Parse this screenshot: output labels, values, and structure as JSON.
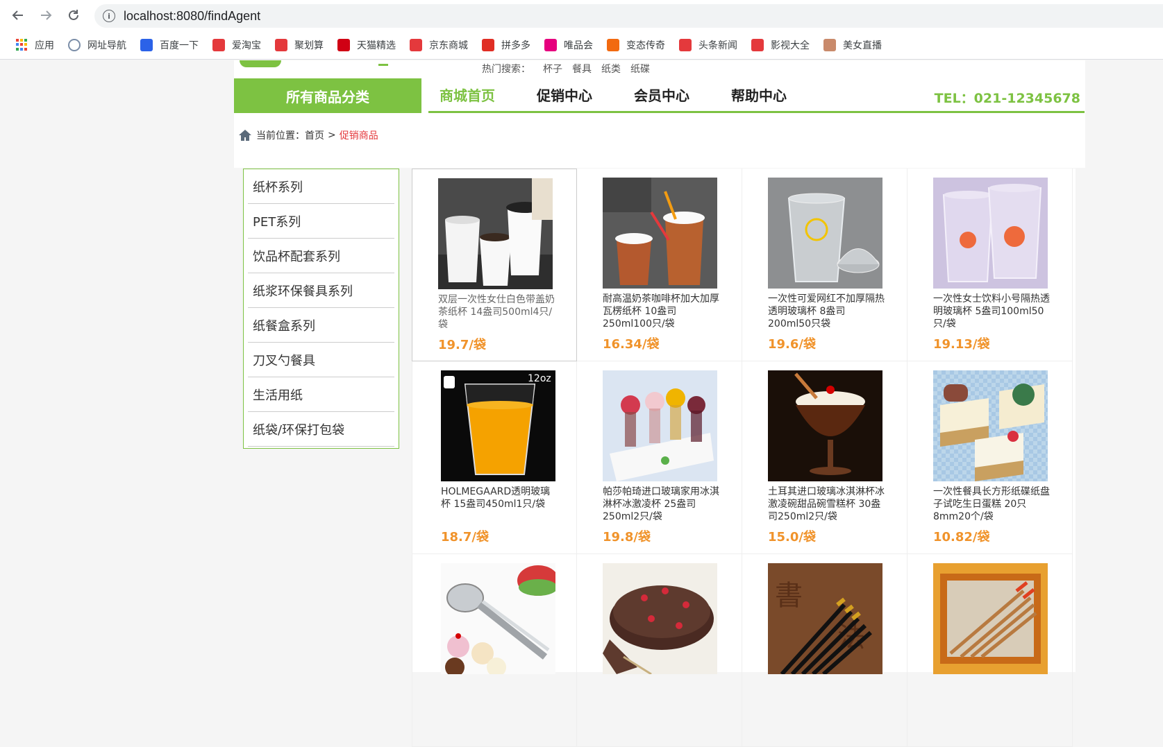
{
  "browser": {
    "url": "localhost:8080/findAgent",
    "bookmarks": [
      {
        "label": "应用",
        "icon": "apps-grid-icon",
        "color": "#4285f4"
      },
      {
        "label": "网址导航",
        "icon": "globe-icon",
        "color": "#7b8ea8"
      },
      {
        "label": "百度一下",
        "icon": "baidu-paw-icon",
        "color": "#2b62e8"
      },
      {
        "label": "爱淘宝",
        "icon": "taobao-icon",
        "color": "#e4393c"
      },
      {
        "label": "聚划算",
        "icon": "juhuasuan-icon",
        "color": "#e4393c"
      },
      {
        "label": "天猫精选",
        "icon": "tmall-icon",
        "color": "#d00014"
      },
      {
        "label": "京东商城",
        "icon": "jd-icon",
        "color": "#e4393c"
      },
      {
        "label": "拼多多",
        "icon": "pinduoduo-icon",
        "color": "#e02e24"
      },
      {
        "label": "唯品会",
        "icon": "vip-icon",
        "color": "#e6007e"
      },
      {
        "label": "变态传奇",
        "icon": "game-icon",
        "color": "#f26a10"
      },
      {
        "label": "头条新闻",
        "icon": "toutiao-icon",
        "color": "#e4393c"
      },
      {
        "label": "影视大全",
        "icon": "play-icon",
        "color": "#e4393c"
      },
      {
        "label": "美女直播",
        "icon": "avatar-icon",
        "color": "#c98a6b"
      }
    ]
  },
  "header": {
    "hot_search_label": "热门搜索：",
    "hot_search": [
      "杯子",
      "餐具",
      "纸类",
      "纸碟"
    ],
    "category_button": "所有商品分类",
    "nav": [
      "商城首页",
      "促销中心",
      "会员中心",
      "帮助中心"
    ],
    "tel": "TEL：021-12345678"
  },
  "breadcrumb": {
    "prefix": "当前位置：",
    "home": "首页",
    "sep": ">",
    "current": "促销商品"
  },
  "sidebar": {
    "items": [
      "纸杯系列",
      "PET系列",
      "饮品杯配套系列",
      "纸浆环保餐具系列",
      "纸餐盒系列",
      "刀叉勺餐具",
      "生活用纸",
      "纸袋/环保打包袋"
    ]
  },
  "products": [
    {
      "name": "双层一次性女仕白色带盖奶茶纸杯 14盎司500ml4只/袋",
      "price": "19.7/袋"
    },
    {
      "name": "耐高温奶茶咖啡杯加大加厚瓦楞纸杯 10盎司250ml100只/袋",
      "price": "16.34/袋"
    },
    {
      "name": "一次性可爱网红不加厚隔热透明玻璃杯 8盎司200ml50只袋",
      "price": "19.6/袋"
    },
    {
      "name": "一次性女士饮料小号隔热透明玻璃杯 5盎司100ml50只/袋",
      "price": "19.13/袋"
    },
    {
      "name": "HOLMEGAARD透明玻璃杯 15盎司450ml1只/袋",
      "price": "18.7/袋",
      "badge": "12oz"
    },
    {
      "name": "帕莎帕琦进口玻璃家用冰淇淋杯冰激凌杯 25盎司250ml2只/袋",
      "price": "19.8/袋"
    },
    {
      "name": "土耳其进口玻璃冰淇淋杯冰激凌碗甜品碗雪糕杯 30盎司250ml2只/袋",
      "price": "15.0/袋"
    },
    {
      "name": "一次性餐具长方形纸碟纸盘子试吃生日蛋糕 20只8mm20个/袋",
      "price": "10.82/袋"
    },
    {
      "name": "",
      "price": ""
    },
    {
      "name": "",
      "price": ""
    },
    {
      "name": "",
      "price": ""
    },
    {
      "name": "",
      "price": ""
    }
  ]
}
